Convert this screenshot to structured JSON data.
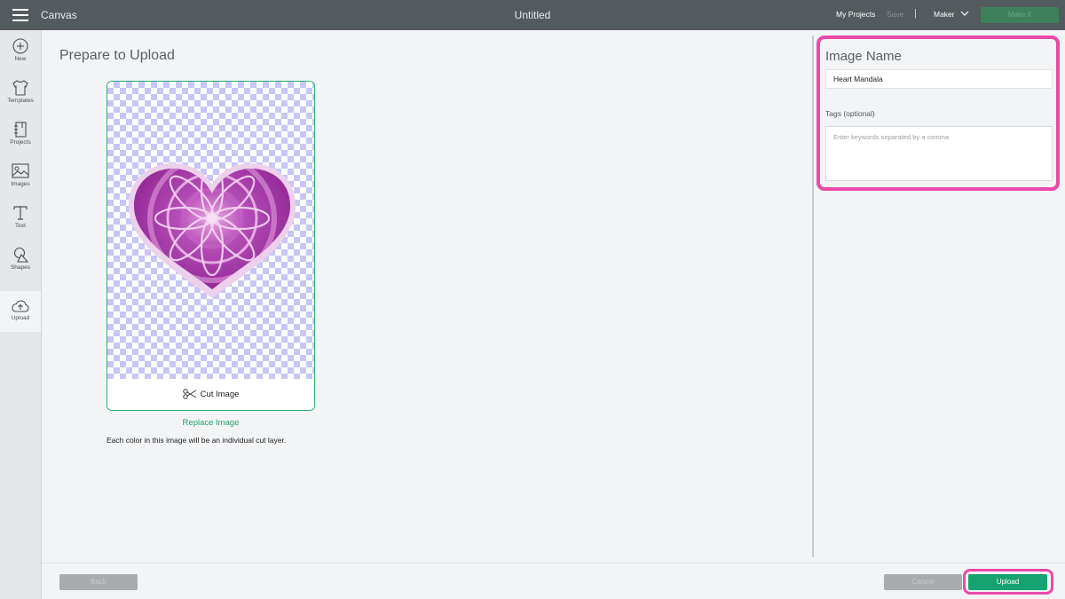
{
  "topbar": {
    "menu_icon": "hamburger-icon",
    "app_title": "Canvas",
    "doc_title": "Untitled",
    "my_projects": "My Projects",
    "save": "Save",
    "separator": "|",
    "machine": "Maker",
    "make_it": "Make It"
  },
  "sidebar": {
    "items": [
      {
        "label": "New",
        "icon": "plus-circle-icon"
      },
      {
        "label": "Templates",
        "icon": "tshirt-icon"
      },
      {
        "label": "Projects",
        "icon": "projects-icon"
      },
      {
        "label": "Images",
        "icon": "image-icon"
      },
      {
        "label": "Text",
        "icon": "text-t-icon"
      },
      {
        "label": "Shapes",
        "icon": "shapes-icon"
      },
      {
        "label": "Upload",
        "icon": "cloud-upload-icon"
      }
    ],
    "active": "Upload"
  },
  "main": {
    "heading": "Prepare to Upload",
    "cut_image": "Cut Image",
    "replace_image": "Replace Image",
    "info": "Each color in this image will be an individual cut layer."
  },
  "right_panel": {
    "title": "Image Name",
    "name_value": "Heart Mandala",
    "tags_label": "Tags (optional)",
    "tags_placeholder": "Enter keywords separated by a comma"
  },
  "footer": {
    "back": "Back",
    "cancel": "Cancel",
    "upload": "Upload"
  },
  "colors": {
    "accent_green": "#17a371",
    "highlight_pink": "#e94aa7",
    "topbar": "#545b5f",
    "heart_purple": "#9b2a9c"
  }
}
